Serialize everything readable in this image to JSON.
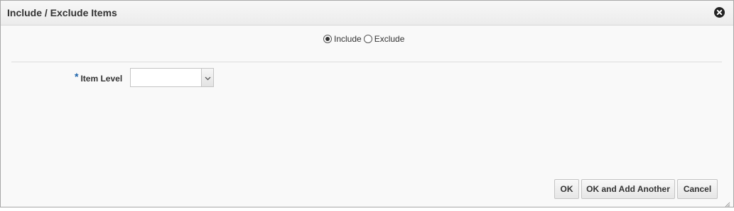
{
  "dialog": {
    "title": "Include / Exclude Items"
  },
  "mode": {
    "options": [
      {
        "label": "Include",
        "selected": true
      },
      {
        "label": "Exclude",
        "selected": false
      }
    ]
  },
  "form": {
    "item_level": {
      "required_marker": "*",
      "label": "Item Level",
      "value": ""
    }
  },
  "buttons": {
    "ok": "OK",
    "ok_add_another": "OK and Add Another",
    "cancel": "Cancel"
  },
  "icons": {
    "close": "close-circle-icon",
    "dropdown": "chevron-down-icon",
    "resize": "resize-grip-icon"
  },
  "colors": {
    "required_marker": "#1a61a9",
    "text": "#333333",
    "background": "#f9f9f9"
  }
}
